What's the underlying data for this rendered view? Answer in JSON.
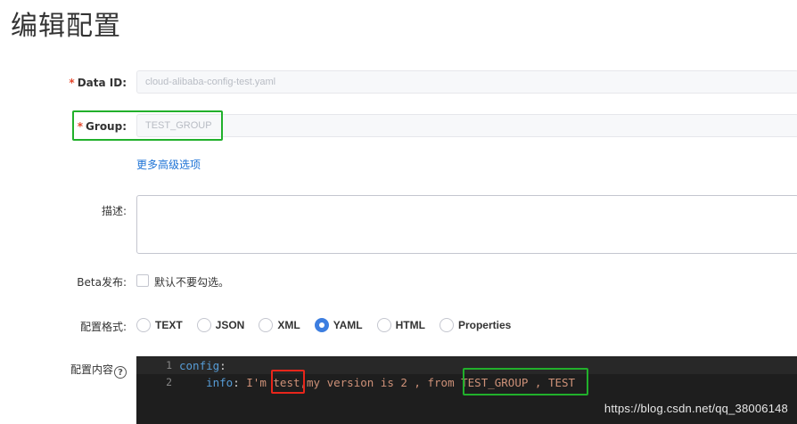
{
  "page": {
    "title": "编辑配置"
  },
  "form": {
    "data_id": {
      "label": "Data ID:",
      "required_mark": "*",
      "value": "cloud-alibaba-config-test.yaml"
    },
    "group": {
      "label": "Group:",
      "required_mark": "*",
      "value": "TEST_GROUP"
    },
    "advanced_link": "更多高级选项",
    "description": {
      "label": "描述:",
      "value": ""
    },
    "beta": {
      "label": "Beta发布:",
      "checkbox_label": "默认不要勾选。"
    },
    "format": {
      "label": "配置格式:",
      "options": [
        "TEXT",
        "JSON",
        "XML",
        "YAML",
        "HTML",
        "Properties"
      ],
      "selected": "YAML"
    },
    "content": {
      "label": "配置内容",
      "help_glyph": "?",
      "lines": [
        {
          "number": "1",
          "key": "config",
          "colon": ":"
        },
        {
          "number": "2",
          "indent": "    ",
          "key": "info",
          "colon": ": ",
          "text_before": "I'm ",
          "text_highlight_red": "test",
          "text_middle": ",my version is 2 , from ",
          "text_highlight_green": "TEST_GROUP , TEST"
        }
      ]
    }
  },
  "watermark": "https://blog.csdn.net/qq_38006148",
  "colors": {
    "required": "#e5482d",
    "link": "#1e73d6",
    "radio_selected": "#3d7ee0",
    "annotation_green": "#21b02b",
    "annotation_red": "#e8261b",
    "editor_bg": "#1e1e1e"
  }
}
